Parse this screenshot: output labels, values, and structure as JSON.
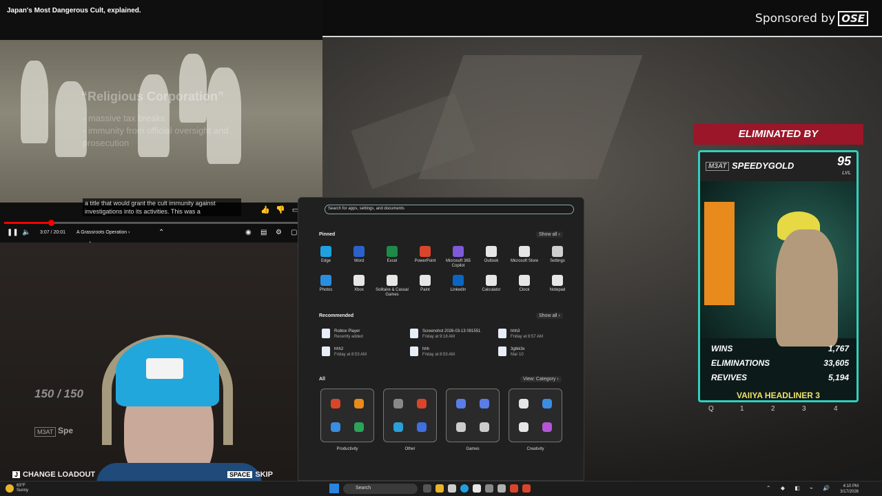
{
  "video": {
    "title": "Japan's Most Dangerous Cult, explained.",
    "overlay_heading": "“Religious Corporation”",
    "overlay_bullets": [
      "- massive tax breaks",
      "- immunity from official oversight and",
      "prosecution"
    ],
    "caption": "a title that would grant the cult immunity against investigations into its activities. This was a",
    "time": "3:07 / 20:01",
    "chapter": "A Grassroots Operation",
    "progress_fraction": 0.15
  },
  "game": {
    "sponsor_text": "Sponsored by",
    "sponsor_logo": "OSE",
    "hp": "150 / 150",
    "tag": "M3AT",
    "name_partial": "Spe",
    "change_loadout": "CHANGE LOADOUT",
    "skip": "SKIP",
    "change_key": "J",
    "skip_key": "SPACE"
  },
  "start_menu": {
    "search_placeholder": "Search for apps, settings, and documents",
    "pinned_label": "Pinned",
    "show_all": "Show all",
    "recommended_label": "Recommended",
    "all_label": "All",
    "view_category": "View: Category",
    "pinned": [
      {
        "label": "Edge",
        "icon": "edge-icon",
        "color": "#1fa0e0"
      },
      {
        "label": "Word",
        "icon": "word-icon",
        "color": "#2b62c9"
      },
      {
        "label": "Excel",
        "icon": "excel-icon",
        "color": "#1e8a47"
      },
      {
        "label": "PowerPoint",
        "icon": "powerpoint-icon",
        "color": "#d9452b"
      },
      {
        "label": "Microsoft 365 Copilot",
        "icon": "copilot-icon",
        "color": "#7f5ad8"
      },
      {
        "label": "Outlook",
        "icon": "outlook-icon",
        "color": "#e6e6e6"
      },
      {
        "label": "Microsoft Store",
        "icon": "store-icon",
        "color": "#e6e6e6"
      },
      {
        "label": "Settings",
        "icon": "gear-icon",
        "color": "#cfcfcf"
      },
      {
        "label": "Photos",
        "icon": "photos-icon",
        "color": "#2a8ee0"
      },
      {
        "label": "Xbox",
        "icon": "xbox-icon",
        "color": "#e6e6e6"
      },
      {
        "label": "Solitaire & Casual Games",
        "icon": "solitaire-icon",
        "color": "#e6e6e6"
      },
      {
        "label": "Paint",
        "icon": "paint-icon",
        "color": "#e6e6e6"
      },
      {
        "label": "LinkedIn",
        "icon": "linkedin-icon",
        "color": "#0a66c2"
      },
      {
        "label": "Calculator",
        "icon": "calculator-icon",
        "color": "#e6e6e6"
      },
      {
        "label": "Clock",
        "icon": "clock-icon",
        "color": "#e6e6e6"
      },
      {
        "label": "Notepad",
        "icon": "notepad-icon",
        "color": "#e6e6e6"
      }
    ],
    "recommended": [
      {
        "title": "Roblox Player",
        "sub": "Recently added"
      },
      {
        "title": "Screenshot 2026-03-13 091551",
        "sub": "Friday at 9:18 AM"
      },
      {
        "title": "hhh3",
        "sub": "Friday at 8:57 AM"
      },
      {
        "title": "hhh2",
        "sub": "Friday at 8:53 AM"
      },
      {
        "title": "hhh",
        "sub": "Friday at 8:53 AM"
      },
      {
        "title": "3gtkk3v",
        "sub": "Mar 10"
      }
    ],
    "folders": [
      {
        "label": "Productivity",
        "colors": [
          "#d9452b",
          "#e88a1c",
          "#3a8de0",
          "#2ba35a"
        ]
      },
      {
        "label": "Other",
        "colors": [
          "#888888",
          "#d9452b",
          "#2a9fd8",
          "#3f6fe0"
        ]
      },
      {
        "label": "Games",
        "colors": [
          "#5b7de8",
          "#5b7de8",
          "#cccccc",
          "#cccccc"
        ]
      },
      {
        "label": "Creativity",
        "colors": [
          "#e6e6e6",
          "#3a8de0",
          "#e6e6e6",
          "#b455d8"
        ]
      }
    ]
  },
  "eliminated": {
    "banner": "ELIMINATED BY",
    "tag": "M3AT",
    "player": "SPEEDYGOLD",
    "level": "95",
    "level_label": "LVL",
    "stats": [
      {
        "label": "WINS",
        "value": "1,767"
      },
      {
        "label": "ELIMINATIONS",
        "value": "33,605"
      },
      {
        "label": "REVIVES",
        "value": "5,194"
      }
    ],
    "badge": "VAIIYA HEADLINER 3",
    "slots": [
      "Q",
      "1",
      "2",
      "3",
      "4"
    ]
  },
  "taskbar": {
    "weather_temp": "63°F",
    "weather_desc": "Sunny",
    "search": "Search",
    "time": "4:10 PM",
    "date": "3/17/2026"
  }
}
